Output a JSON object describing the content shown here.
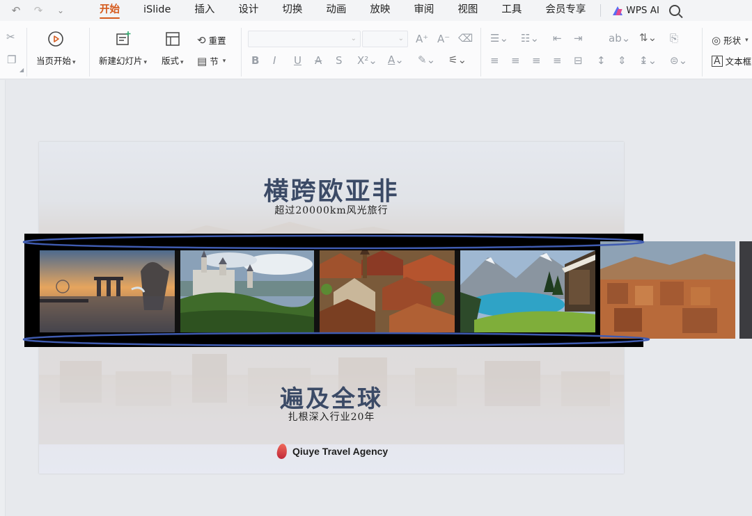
{
  "menubar": {
    "tabs": [
      {
        "label": "开始",
        "active": true
      },
      {
        "label": "iSlide"
      },
      {
        "label": "插入"
      },
      {
        "label": "设计"
      },
      {
        "label": "切换"
      },
      {
        "label": "动画"
      },
      {
        "label": "放映"
      },
      {
        "label": "审阅"
      },
      {
        "label": "视图"
      },
      {
        "label": "工具"
      },
      {
        "label": "会员专享"
      }
    ],
    "wps_ai": "WPS AI",
    "accent_color": "#d55a1d"
  },
  "ribbon": {
    "start_show": "当页开始",
    "new_slide": "新建幻灯片",
    "layout": "版式",
    "reset": "重置",
    "section": "节",
    "shape": "形状",
    "textbox": "文本框"
  },
  "slide": {
    "title1": "横跨欧亚非",
    "subtitle1": "超过20000km风光旅行",
    "title2": "遍及全球",
    "subtitle2": "扎根深入行业20年",
    "brand": "Qiuye Travel Agency",
    "title_color": "#3b4a66"
  },
  "film": {
    "photos": [
      "singapore-merlion",
      "neuschwanstein-castle",
      "old-town-rooftops",
      "alpine-lake",
      "desert-kasbah"
    ]
  }
}
